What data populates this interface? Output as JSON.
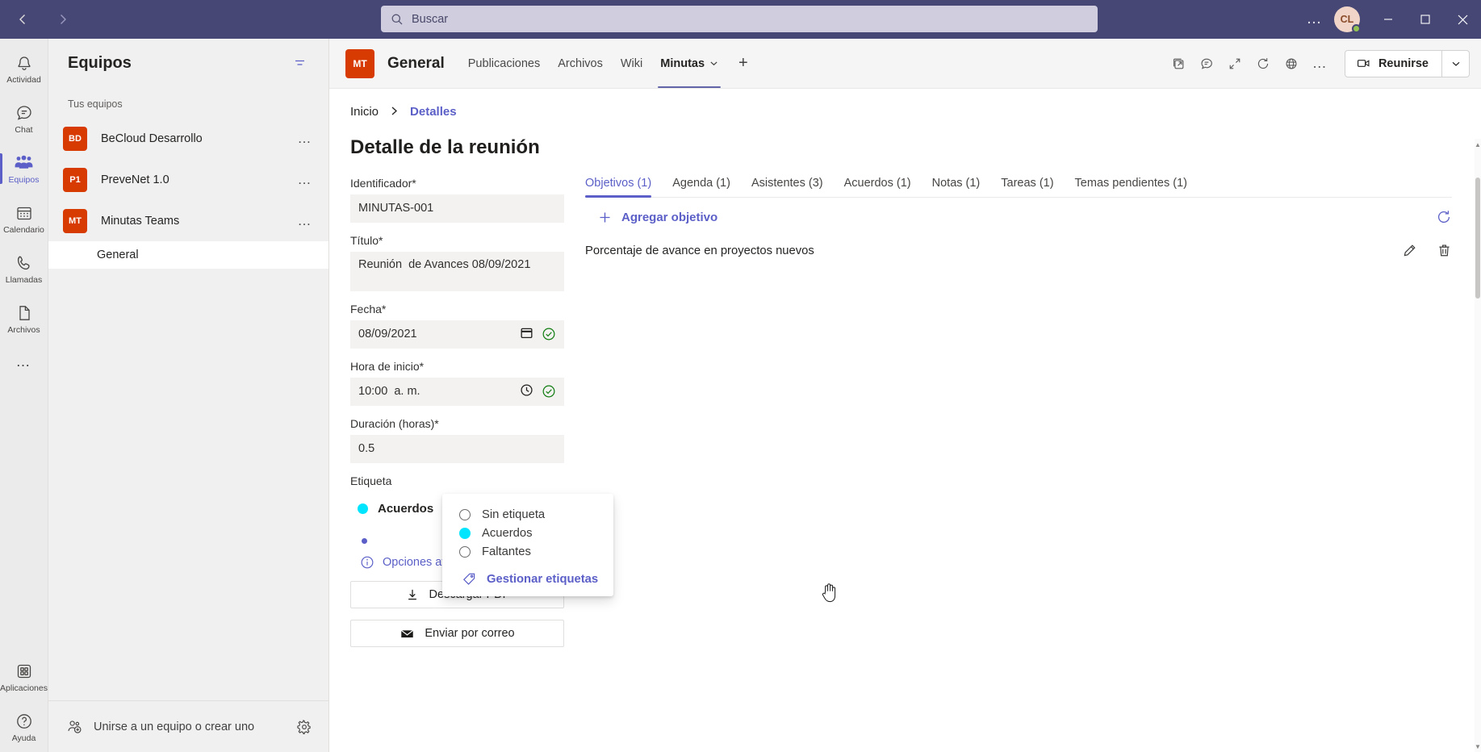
{
  "titlebar": {
    "back_tooltip": "Atrás",
    "forward_tooltip": "Adelante",
    "search_placeholder": "Buscar",
    "search_value": "",
    "more_label": "…",
    "avatar_initials": "CL",
    "minimize_label": "—",
    "maximize_label": "□",
    "close_label": "✕"
  },
  "rail": {
    "items": [
      {
        "label": "Actividad",
        "icon": "bell-icon",
        "active": false
      },
      {
        "label": "Chat",
        "icon": "chat-icon",
        "active": false
      },
      {
        "label": "Equipos",
        "icon": "teams-icon",
        "active": true
      },
      {
        "label": "Calendario",
        "icon": "calendar-icon",
        "active": false
      },
      {
        "label": "Llamadas",
        "icon": "phone-icon",
        "active": false
      },
      {
        "label": "Archivos",
        "icon": "file-icon",
        "active": false
      }
    ],
    "more_label": "…",
    "bottom_items": [
      {
        "label": "Aplicaciones",
        "icon": "apps-icon"
      },
      {
        "label": "Ayuda",
        "icon": "help-icon"
      }
    ]
  },
  "teams_pane": {
    "title": "Equipos",
    "filter_icon": "filter-icon",
    "section_label": "Tus equipos",
    "teams": [
      {
        "initials": "BD",
        "name": "BeCloud Desarrollo",
        "more": "…"
      },
      {
        "initials": "P1",
        "name": "PreveNet 1.0",
        "more": "…"
      },
      {
        "initials": "MT",
        "name": "Minutas Teams",
        "more": "…"
      }
    ],
    "channels": [
      {
        "name": "General",
        "selected": true
      }
    ],
    "join_label": "Unirse a un equipo o crear uno",
    "join_icon": "add-person-icon",
    "settings_icon": "gear-icon"
  },
  "channel_header": {
    "team_initials": "MT",
    "channel_name": "General",
    "tabs": [
      {
        "label": "Publicaciones",
        "active": false,
        "caret": false
      },
      {
        "label": "Archivos",
        "active": false,
        "caret": false
      },
      {
        "label": "Wiki",
        "active": false,
        "caret": false
      },
      {
        "label": "Minutas",
        "active": true,
        "caret": true
      }
    ],
    "add_tab_label": "+",
    "actions": [
      {
        "icon": "open-in-new-icon",
        "name": "open-in-new"
      },
      {
        "icon": "chat-bubble-icon",
        "name": "conversation"
      },
      {
        "icon": "expand-icon",
        "name": "full-screen"
      },
      {
        "icon": "refresh-icon",
        "name": "refresh"
      },
      {
        "icon": "globe-icon",
        "name": "website"
      },
      {
        "icon": "more-icon",
        "name": "more-options"
      }
    ],
    "meet_label": "Reunirse",
    "meet_icon": "video-camera-icon",
    "meet_caret": "chevron-down-icon"
  },
  "breadcrumb": {
    "home": "Inicio",
    "separator": "›",
    "current": "Detalles"
  },
  "page": {
    "title": "Detalle de la reunión"
  },
  "form": {
    "fields": [
      {
        "label": "Identificador*",
        "value": "MINUTAS-001",
        "icons": []
      },
      {
        "label": "Título*",
        "value": "Reunión  de Avances 08/09/2021",
        "icons": []
      },
      {
        "label": "Fecha*",
        "value": "08/09/2021",
        "icons": [
          "calendar-icon",
          "check-circle-icon"
        ]
      },
      {
        "label": "Hora de inicio*",
        "value": "10:00  a. m.",
        "icons": [
          "clock-icon",
          "check-circle-icon"
        ]
      },
      {
        "label": "Duración (horas)*",
        "value": "0.5",
        "icons": []
      }
    ],
    "tag_label": "Etiqueta",
    "tag_selected": "Acuerdos",
    "tag_color": "#00e5ff",
    "advanced_label": "Opciones avanzadas",
    "advanced_icon": "info-icon",
    "buttons": [
      {
        "label": "Descargar PDF",
        "icon": "download-icon"
      },
      {
        "label": "Enviar por correo",
        "icon": "mail-icon"
      }
    ]
  },
  "tag_menu": {
    "options": [
      {
        "label": "Sin etiqueta",
        "selected": false,
        "color": ""
      },
      {
        "label": "Acuerdos",
        "selected": true,
        "color": "#00e5ff"
      },
      {
        "label": "Faltantes",
        "selected": false,
        "color": ""
      }
    ],
    "manage_label": "Gestionar etiquetas",
    "manage_icon": "tag-icon"
  },
  "detail_panel": {
    "tabs": [
      {
        "label": "Objetivos (1)",
        "active": true
      },
      {
        "label": "Agenda (1)",
        "active": false
      },
      {
        "label": "Asistentes (3)",
        "active": false
      },
      {
        "label": "Acuerdos (1)",
        "active": false
      },
      {
        "label": "Notas (1)",
        "active": false
      },
      {
        "label": "Tareas (1)",
        "active": false
      },
      {
        "label": "Temas pendientes (1)",
        "active": false
      }
    ],
    "add_label": "Agregar objetivo",
    "add_icon": "plus-icon",
    "refresh_icon": "refresh-icon",
    "rows": [
      {
        "text": "Porcentaje de avance en proyectos nuevos",
        "edit_icon": "pencil-icon",
        "delete_icon": "trash-icon"
      }
    ]
  }
}
